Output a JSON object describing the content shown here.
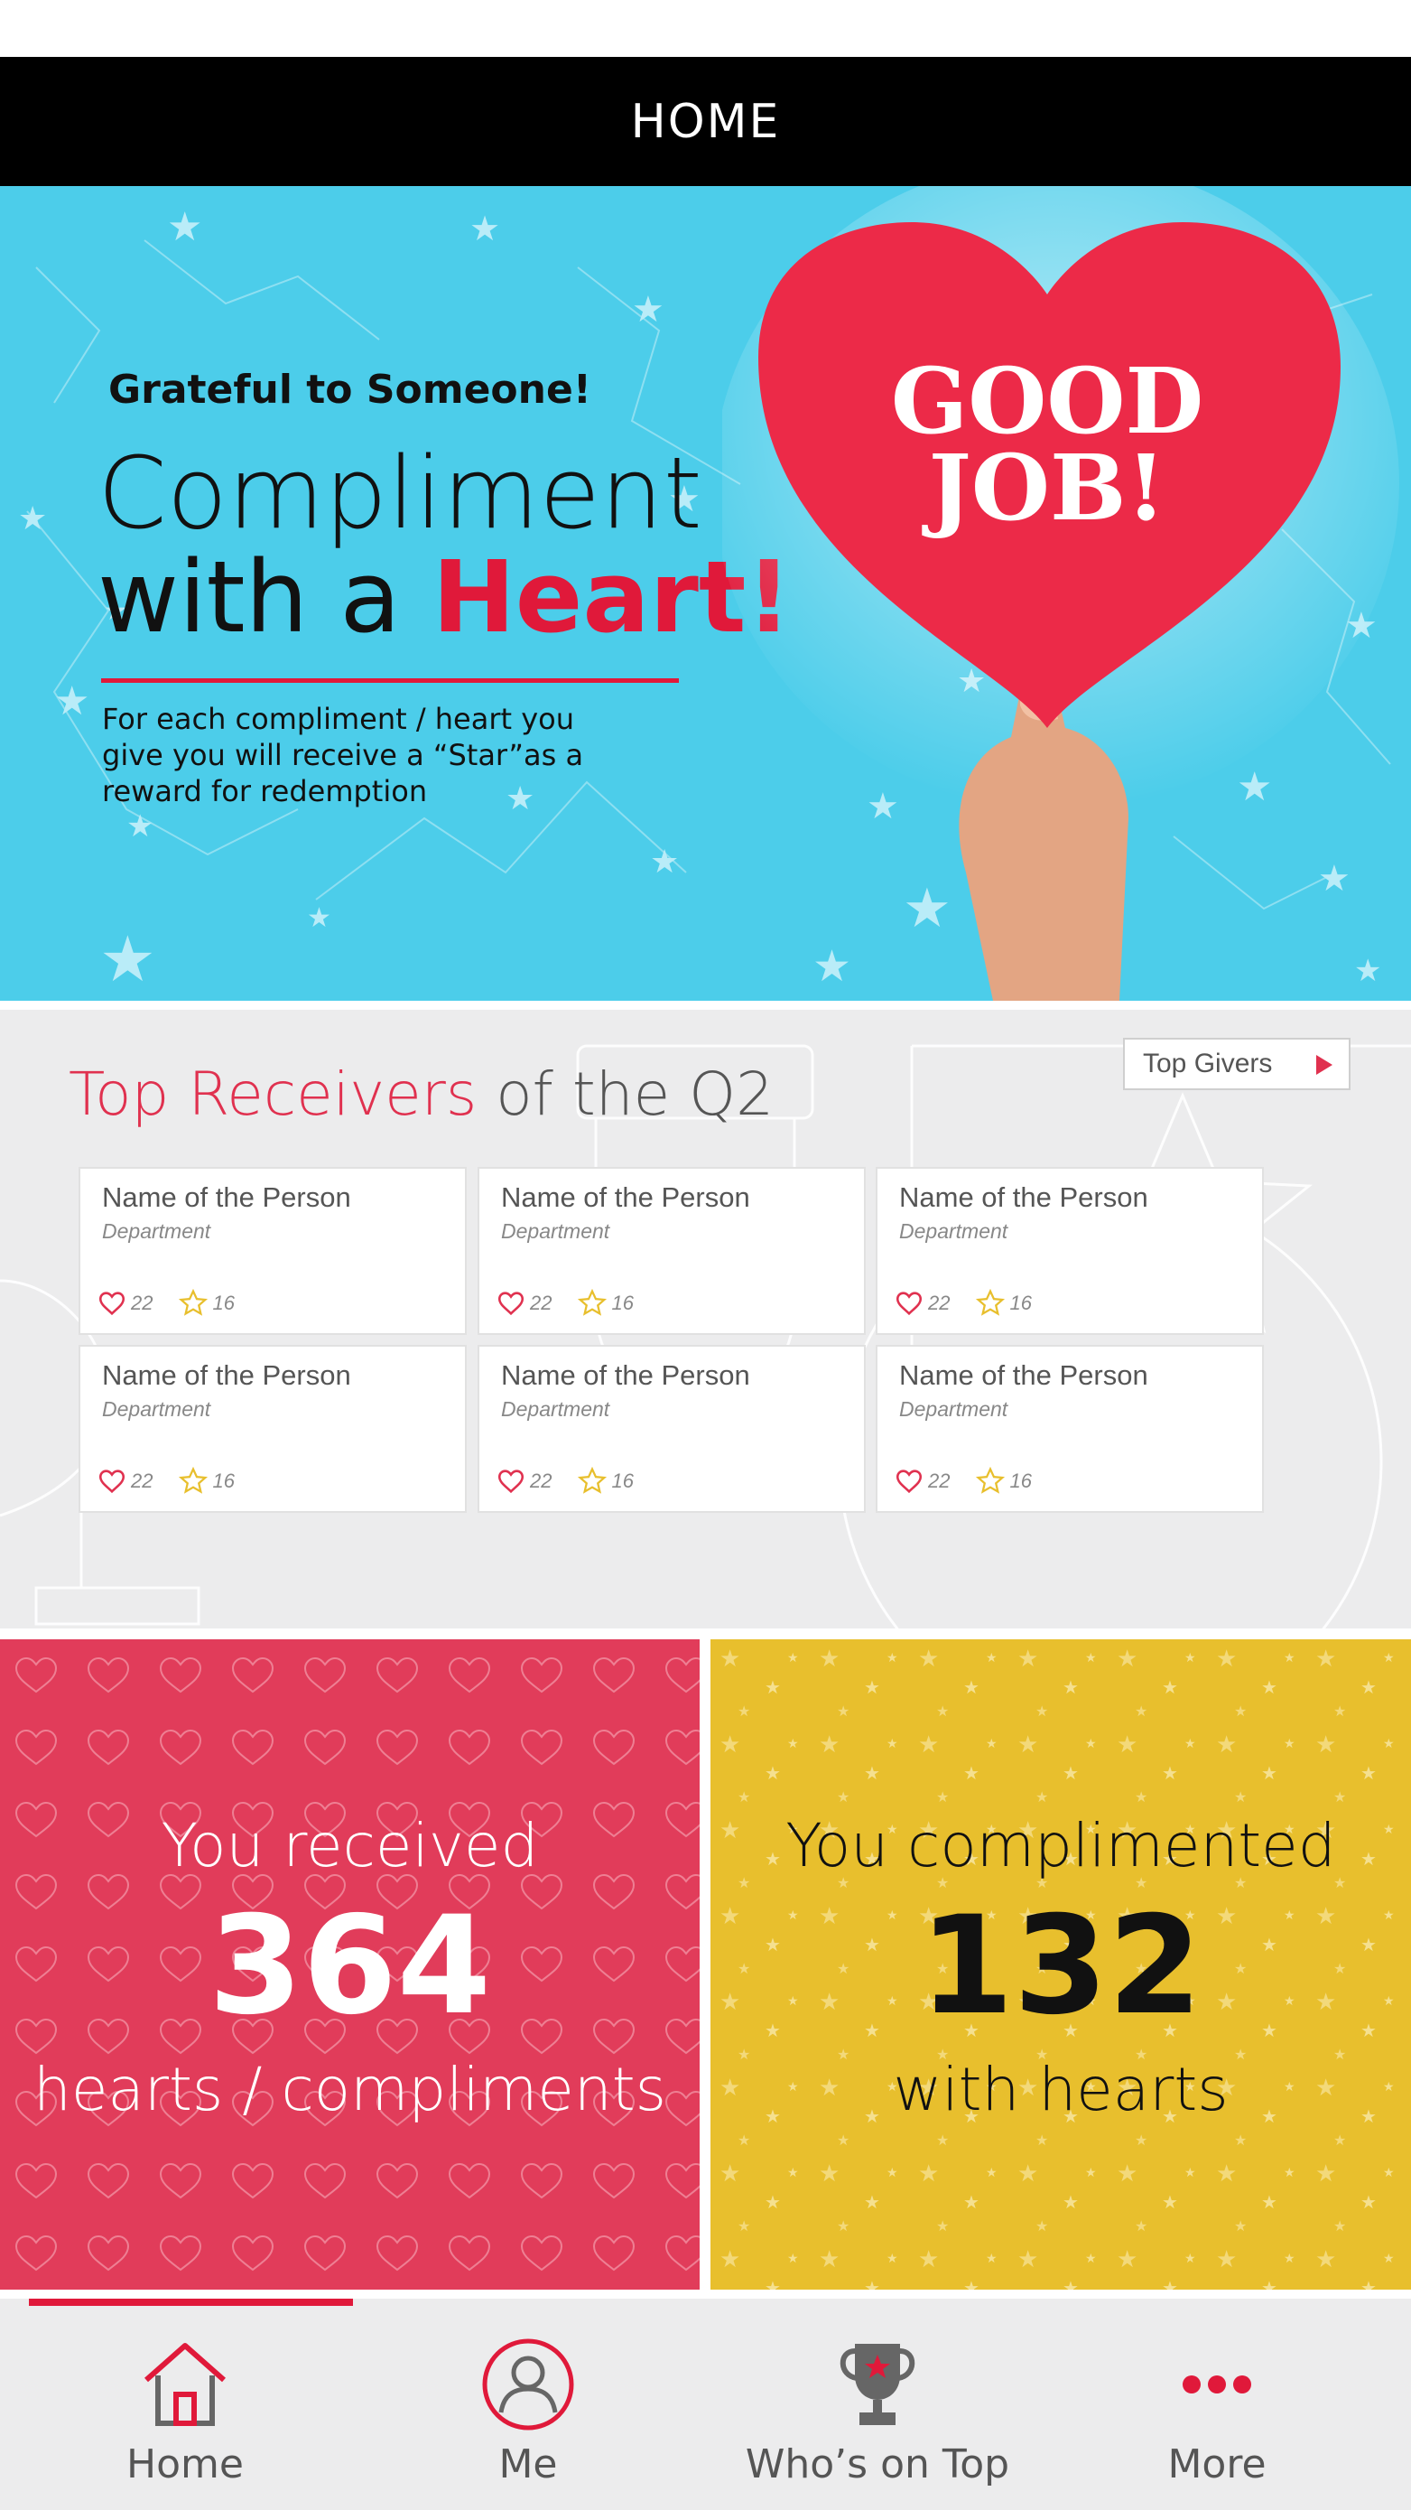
{
  "header": {
    "title": "HOME"
  },
  "hero": {
    "kicker": "Grateful to Someone!",
    "title_line1": "Compliment",
    "title_line2_prefix": "with a ",
    "title_line2_accent": "Heart!",
    "description": "For each compliment / heart you give you will receive a “Star”as a reward for redemption",
    "heart_text_line1": "GOOD",
    "heart_text_line2": "JOB!"
  },
  "receivers": {
    "title_accent": "Top Receivers",
    "title_rest": " of the Q2",
    "top_givers_label": "Top Givers",
    "people": [
      {
        "name": "Name of the Person",
        "department": "Department",
        "hearts": "22",
        "stars": "16"
      },
      {
        "name": "Name of the Person",
        "department": "Department",
        "hearts": "22",
        "stars": "16"
      },
      {
        "name": "Name of the Person",
        "department": "Department",
        "hearts": "22",
        "stars": "16"
      },
      {
        "name": "Name of the Person",
        "department": "Department",
        "hearts": "22",
        "stars": "16"
      },
      {
        "name": "Name of the Person",
        "department": "Department",
        "hearts": "22",
        "stars": "16"
      },
      {
        "name": "Name of the Person",
        "department": "Department",
        "hearts": "22",
        "stars": "16"
      }
    ]
  },
  "summary": {
    "received": {
      "line1": "You received",
      "number": "364",
      "line2": "hearts / compliments"
    },
    "complimented": {
      "line1": "You complimented",
      "number": "132",
      "line2": "with hearts"
    }
  },
  "nav": {
    "items": [
      {
        "label": "Home",
        "icon": "home-icon"
      },
      {
        "label": "Me",
        "icon": "user-icon"
      },
      {
        "label": "Who’s on Top",
        "icon": "trophy-icon"
      },
      {
        "label": "More",
        "icon": "more-icon"
      }
    ],
    "active": "Home"
  },
  "colors": {
    "accent_red": "#e0193a",
    "hero_blue": "#4ccdea",
    "tile_red": "#e13c5a",
    "tile_yellow": "#e8bf2d",
    "header_black": "#000000"
  }
}
